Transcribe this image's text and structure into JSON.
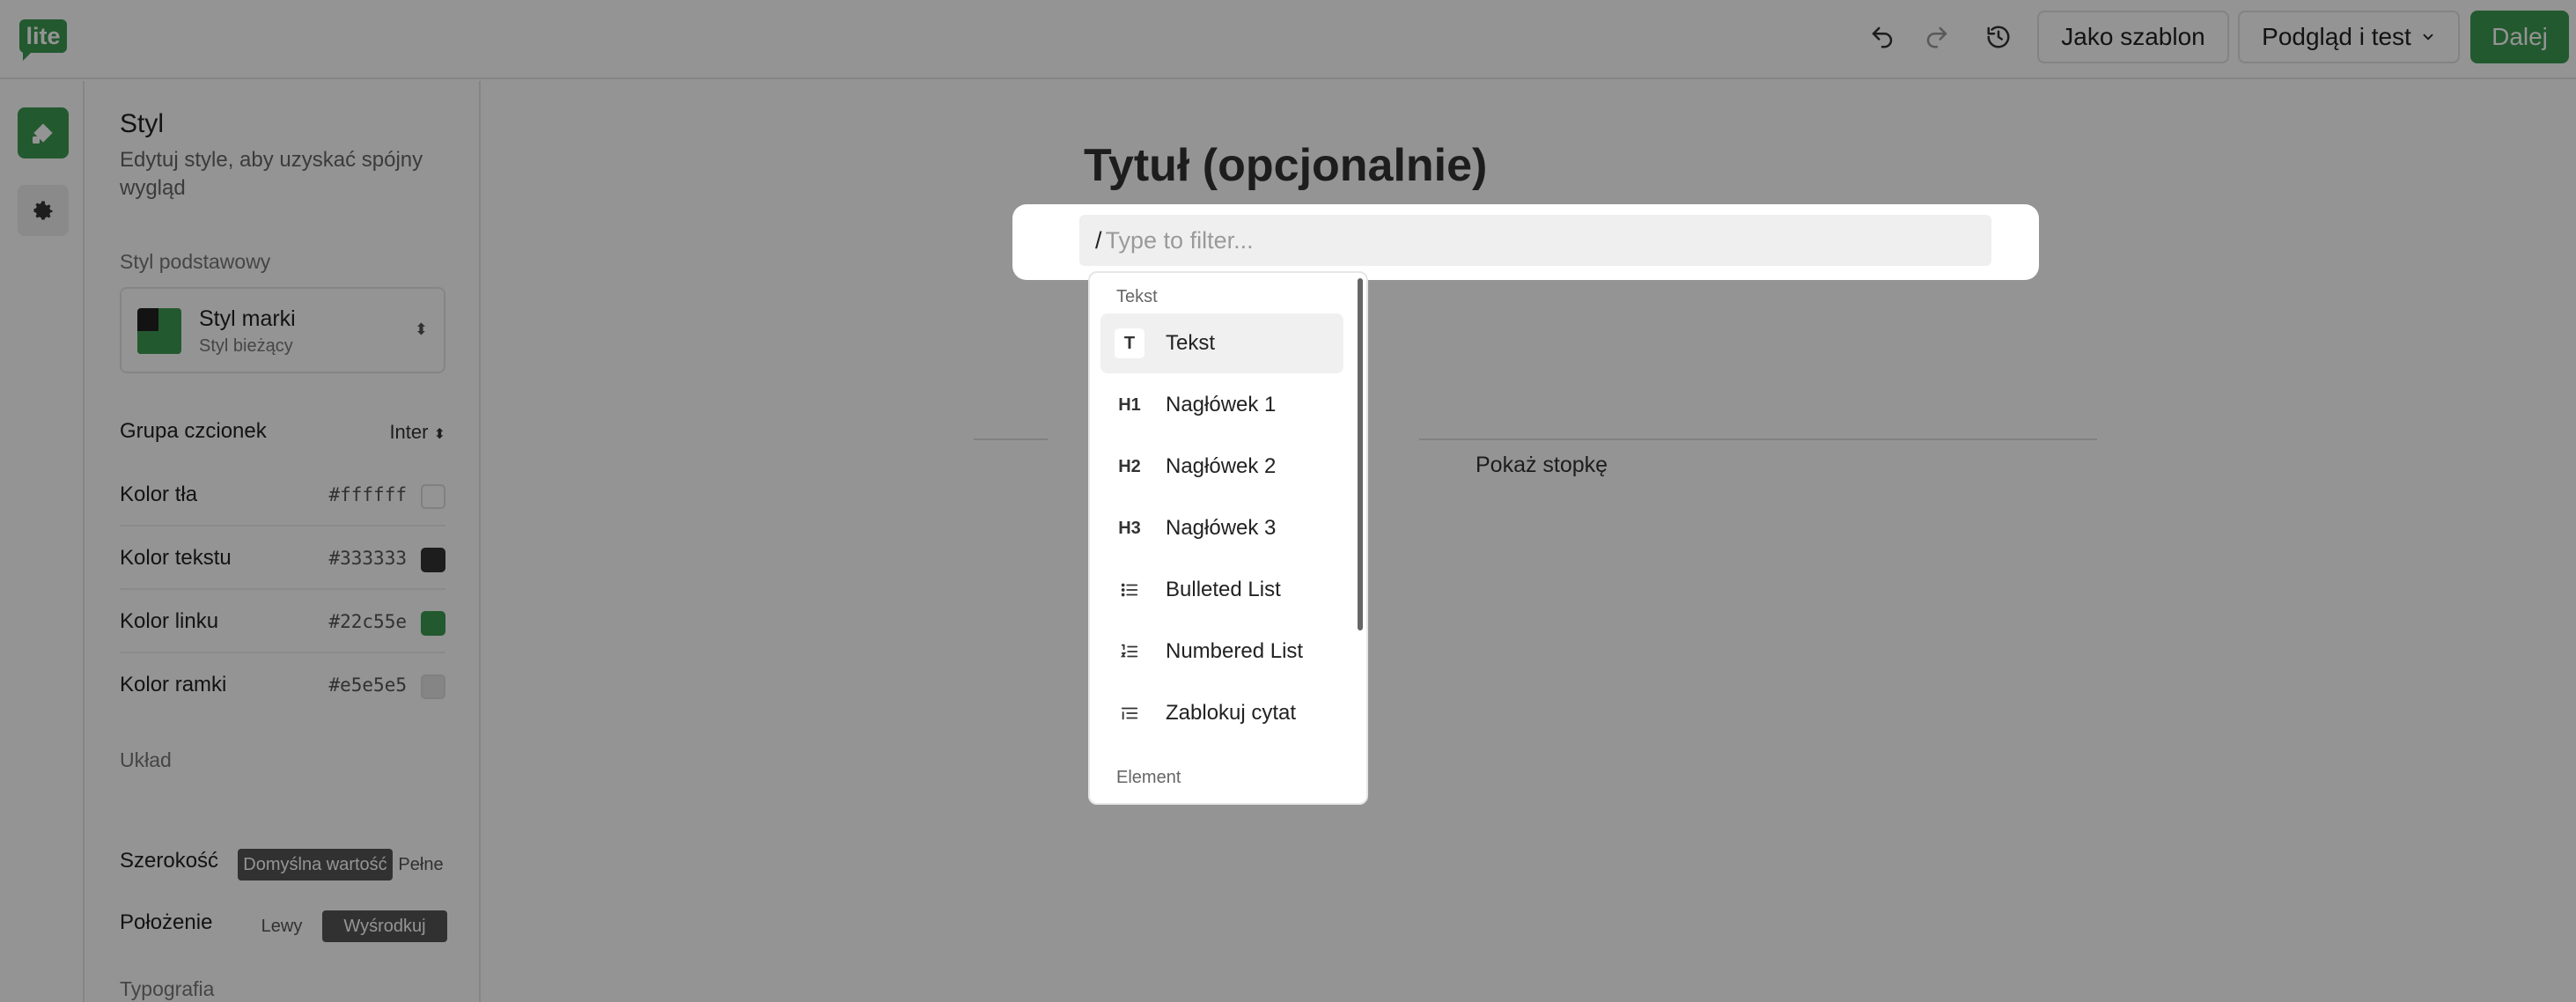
{
  "app": {
    "logo_text": "lite"
  },
  "toolbar": {
    "template_label": "Jako szablon",
    "preview_label": "Podgląd i test",
    "next_label": "Dalej",
    "icons": [
      "undo-icon",
      "redo-icon",
      "history-icon"
    ]
  },
  "panel": {
    "title": "Styl",
    "subtitle": "Edytuj style, aby uzyskać spójny wygląd",
    "base_style_heading": "Styl podstawowy",
    "brand_name": "Styl marki",
    "brand_current": "Styl bieżący",
    "font_group_label": "Grupa czcionek",
    "font_group_value": "Inter",
    "colors": [
      {
        "label": "Kolor tła",
        "value": "#ffffff",
        "swatch": "#ffffff"
      },
      {
        "label": "Kolor tekstu",
        "value": "#333333",
        "swatch": "#333333"
      },
      {
        "label": "Kolor linku",
        "value": "#22c55e",
        "swatch": "#3d9a52"
      },
      {
        "label": "Kolor ramki",
        "value": "#e5e5e5",
        "swatch": "#e5e5e5"
      }
    ],
    "layout_heading": "Układ",
    "width_label": "Szerokość",
    "width_options": [
      "Domyślna wartość",
      "Pełne"
    ],
    "position_label": "Położenie",
    "position_options": [
      "Lewy",
      "Wyśrodkuj"
    ],
    "typography_heading": "Typografia"
  },
  "canvas": {
    "title_placeholder": "Tytuł (opcjonalnie)",
    "footer_toggle": "Pokaż stopkę"
  },
  "filter": {
    "slash": "/",
    "placeholder": "Type to filter..."
  },
  "menu": {
    "group_text": "Tekst",
    "group_element": "Element",
    "items": [
      {
        "label": "Tekst",
        "icon": "T"
      },
      {
        "label": "Nagłówek 1",
        "icon": "H1"
      },
      {
        "label": "Nagłówek 2",
        "icon": "H2"
      },
      {
        "label": "Nagłówek 3",
        "icon": "H3"
      },
      {
        "label": "Bulleted List",
        "icon": "bulleted-list-icon"
      },
      {
        "label": "Numbered List",
        "icon": "numbered-list-icon"
      },
      {
        "label": "Zablokuj cytat",
        "icon": "blockquote-icon"
      }
    ]
  },
  "colors": {
    "accent": "#3d9a52",
    "overlay": "rgba(0,0,0,0.42)"
  }
}
